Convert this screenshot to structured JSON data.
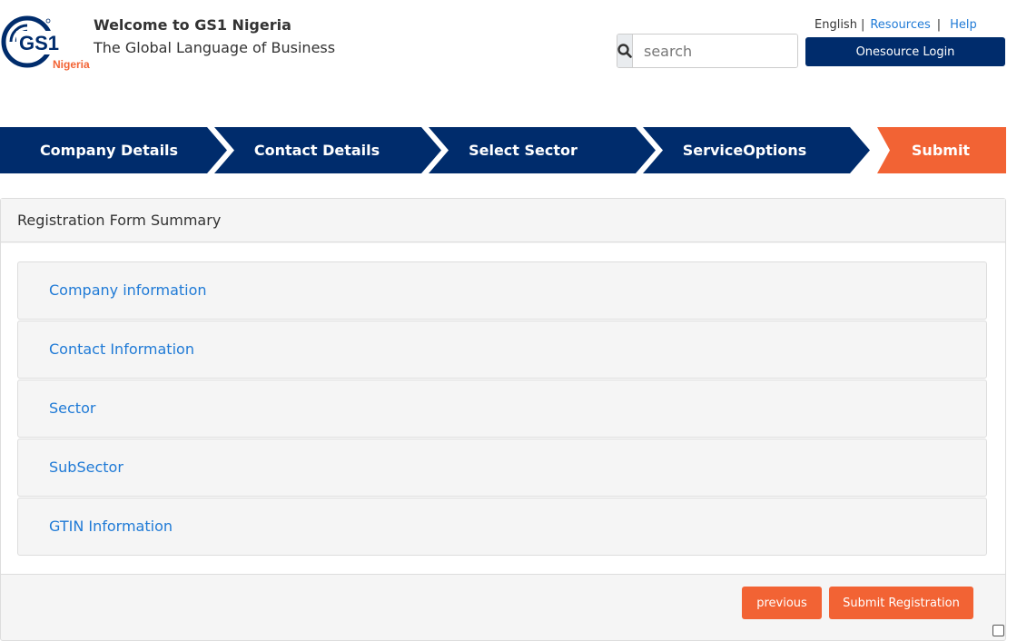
{
  "header": {
    "welcome": "Welcome to GS1 Nigeria",
    "tagline": "The Global Language of Business",
    "logo_text": "GS1",
    "logo_country": "Nigeria"
  },
  "toplinks": {
    "language": "English",
    "resources": "Resources",
    "help": "Help"
  },
  "search": {
    "placeholder": "search"
  },
  "login_label": "Onesource Login",
  "steps": [
    {
      "label": "Company Details",
      "state": "done"
    },
    {
      "label": "Contact Details",
      "state": "done"
    },
    {
      "label": "Select Sector",
      "state": "done"
    },
    {
      "label": "ServiceOptions",
      "state": "done"
    },
    {
      "label": "Submit",
      "state": "active"
    }
  ],
  "summary": {
    "title": "Registration Form Summary",
    "sections": [
      "Company information",
      "Contact Information",
      "Sector",
      "SubSector",
      "GTIN Information"
    ]
  },
  "buttons": {
    "previous": "previous",
    "submit": "Submit Registration"
  },
  "colors": {
    "navy": "#002c6c",
    "orange": "#f26334",
    "link": "#1f7ad6"
  }
}
